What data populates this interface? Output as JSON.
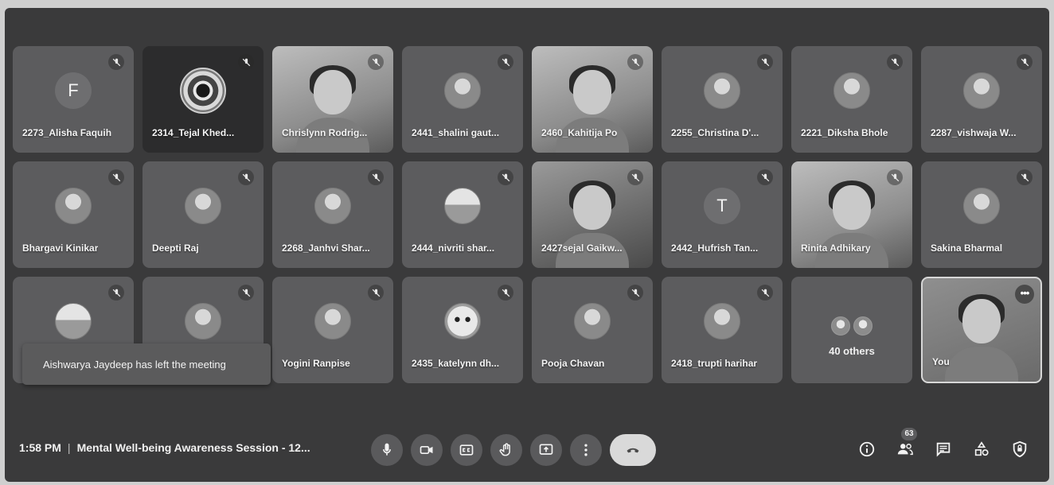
{
  "participants": [
    {
      "name": "2273_Alisha Faquih",
      "initial": "F"
    },
    {
      "name": "2314_Tejal Khed..."
    },
    {
      "name": "Chrislynn Rodrig..."
    },
    {
      "name": "2441_shalini gaut..."
    },
    {
      "name": "2460_Kahitija Po"
    },
    {
      "name": "2255_Christina D'..."
    },
    {
      "name": "2221_Diksha Bhole"
    },
    {
      "name": "2287_vishwaja W..."
    },
    {
      "name": "Bhargavi Kinikar"
    },
    {
      "name": "Deepti Raj"
    },
    {
      "name": "2268_Janhvi Shar..."
    },
    {
      "name": "2444_nivriti shar..."
    },
    {
      "name": "2427sejal Gaikw..."
    },
    {
      "name": "2442_Hufrish Tan...",
      "initial": "T"
    },
    {
      "name": "Rinita Adhikary"
    },
    {
      "name": "Sakina Bharmal"
    },
    {
      "name": ""
    },
    {
      "name": ""
    },
    {
      "name": "Yogini Ranpise"
    },
    {
      "name": "2435_katelynn dh..."
    },
    {
      "name": "Pooja Chavan"
    },
    {
      "name": "2418_trupti harihar"
    }
  ],
  "others": {
    "label": "40 others"
  },
  "self": {
    "label": "You",
    "more": "•••"
  },
  "toast": {
    "message": "Aishwarya Jaydeep has left the meeting"
  },
  "meeting": {
    "time": "1:58 PM",
    "separator": "|",
    "title": "Mental Well-being Awareness Session - 12..."
  },
  "people_count": "63",
  "icons": {
    "mic": "mic-icon",
    "camera": "camera-icon",
    "captions": "captions-icon",
    "hand": "raise-hand-icon",
    "present": "present-icon",
    "more": "more-vert-icon",
    "end": "end-call-icon",
    "info": "info-icon",
    "people": "people-icon",
    "chat": "chat-icon",
    "activities": "activities-icon",
    "host": "host-controls-icon"
  }
}
